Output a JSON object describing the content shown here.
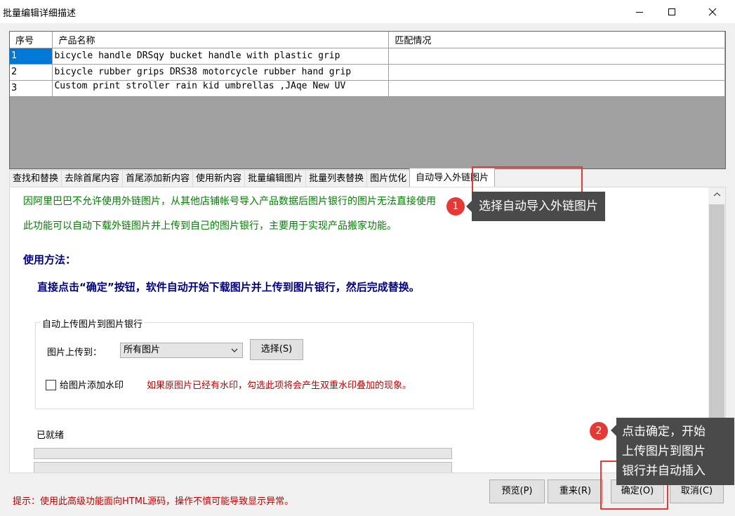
{
  "window": {
    "title": "批量编辑详细描述"
  },
  "grid": {
    "columns": [
      "序号",
      "产品名称",
      "匹配情况"
    ],
    "rows": [
      {
        "index": "1",
        "name": "bicycle handle DRSqy bucket handle with plastic grip",
        "match": ""
      },
      {
        "index": "2",
        "name": "bicycle rubber grips DRS38 motorcycle rubber hand grip",
        "match": ""
      },
      {
        "index": "3",
        "name": "Custom print stroller rain kid umbrellas ,JAqe New  UV",
        "match": ""
      }
    ]
  },
  "tabs": [
    {
      "label": "查找和替换"
    },
    {
      "label": "去除首尾内容"
    },
    {
      "label": "首尾添加新内容"
    },
    {
      "label": "使用新内容"
    },
    {
      "label": "批量编辑图片"
    },
    {
      "label": "批量列表替换"
    },
    {
      "label": "图片优化"
    },
    {
      "label": "自动导入外链图片",
      "active": true
    }
  ],
  "panel": {
    "info_line1": "因阿里巴巴不允许使用外链图片，从其他店铺帐号导入产品数据后图片银行的图片无法直接使用",
    "info_line2": "此功能可以自动下载外链图片并上传到自己的图片银行，主要用于实现产品搬家功能。",
    "usage_heading": "使用方法：",
    "usage_text": "直接点击“确定”按钮，软件自动开始下载图片并上传到图片银行，然后完成替换。",
    "group_title": "自动上传图片到图片银行",
    "upload_to_label": "图片上传到：",
    "upload_to_value": "所有图片",
    "choose_button": "选择(S)",
    "watermark_label": "给图片添加水印",
    "watermark_checked": false,
    "watermark_warning": "如果原图片已经有水印，勾选此项将会产生双重水印叠加的现象。",
    "status": "已就绪",
    "progress1": 0,
    "progress2": 0
  },
  "footer": {
    "hint": "提示：使用此高级功能面向HTML源码，操作不慎可能导致显示异常。",
    "preview_button": "预览(P)",
    "reset_button": "重来(R)",
    "ok_button": "确定(O)",
    "cancel_button": "取消(C)"
  },
  "annotations": {
    "step1_number": "1",
    "step1_text": "选择自动导入外链图片",
    "step2_number": "2",
    "step2_line1": "点击确定，开始",
    "step2_line2": "上传图片到图片",
    "step2_line3": "银行并自动插入",
    "highlight_color": "#e53935",
    "tooltip_bg": "#4a4a4a"
  },
  "colors": {
    "selection": "#0078d7",
    "info_green": "#008000",
    "heading_navy": "#000080",
    "warning_red": "#c00000"
  }
}
